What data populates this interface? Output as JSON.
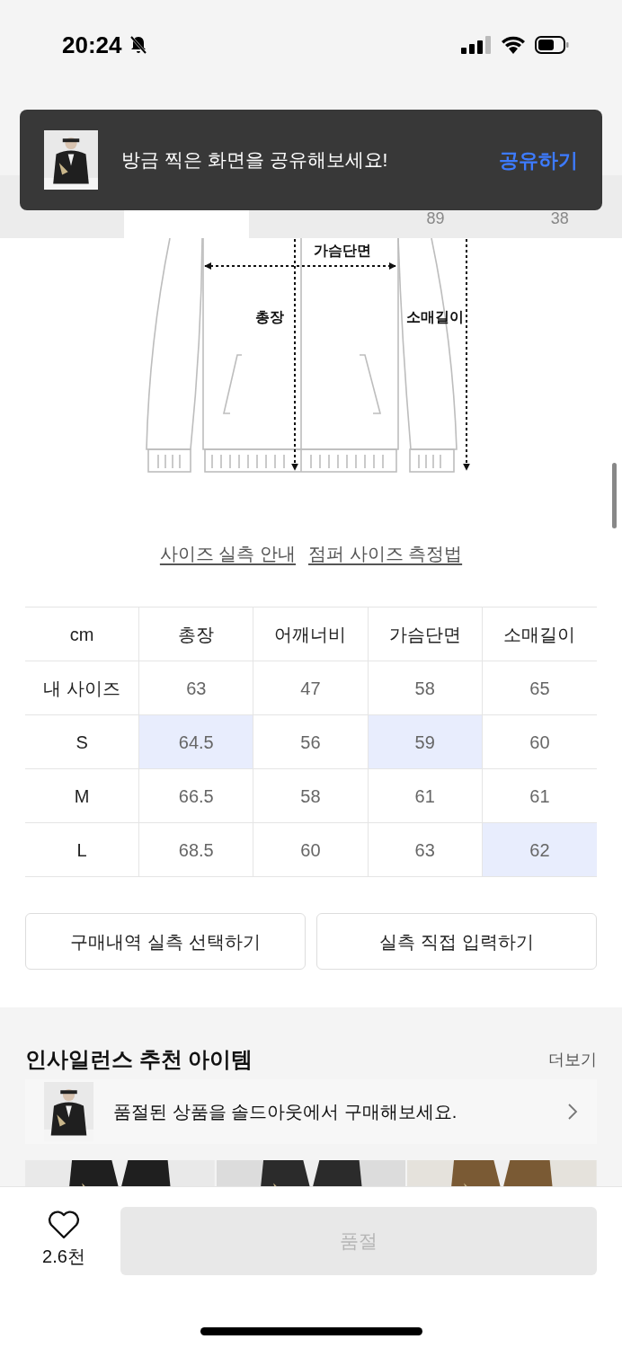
{
  "status_bar": {
    "time": "20:24"
  },
  "toast": {
    "message": "방금 찍은 화면을 공유해보세요!",
    "action": "공유하기"
  },
  "tabs": [
    {
      "selected": false
    },
    {
      "selected": true
    },
    {
      "selected": false
    },
    {
      "selected": false,
      "count": "89"
    },
    {
      "selected": false,
      "count": "38"
    }
  ],
  "size_diagram": {
    "labels": [
      "가슴단면",
      "총장",
      "소매길이"
    ]
  },
  "guide_links": [
    "사이즈 실측 안내",
    "점퍼 사이즈 측정법"
  ],
  "size_table": {
    "columns": [
      "cm",
      "총장",
      "어깨너비",
      "가슴단면",
      "소매길이"
    ],
    "rows": [
      {
        "cells": [
          {
            "text": "내 사이즈",
            "highlighted": false
          },
          {
            "text": "63",
            "highlighted": false
          },
          {
            "text": "47",
            "highlighted": false
          },
          {
            "text": "58",
            "highlighted": false
          },
          {
            "text": "65",
            "highlighted": false
          }
        ]
      },
      {
        "cells": [
          {
            "text": "S",
            "highlighted": false
          },
          {
            "text": "64.5",
            "highlighted": true
          },
          {
            "text": "56",
            "highlighted": false
          },
          {
            "text": "59",
            "highlighted": true
          },
          {
            "text": "60",
            "highlighted": false
          }
        ]
      },
      {
        "cells": [
          {
            "text": "M",
            "highlighted": false
          },
          {
            "text": "66.5",
            "highlighted": false
          },
          {
            "text": "58",
            "highlighted": false
          },
          {
            "text": "61",
            "highlighted": false
          },
          {
            "text": "61",
            "highlighted": false
          }
        ]
      },
      {
        "cells": [
          {
            "text": "L",
            "highlighted": false
          },
          {
            "text": "68.5",
            "highlighted": false
          },
          {
            "text": "60",
            "highlighted": false
          },
          {
            "text": "63",
            "highlighted": false
          },
          {
            "text": "62",
            "highlighted": true
          }
        ]
      }
    ]
  },
  "action_buttons": [
    "구매내역 실측 선택하기",
    "실측 직접 입력하기"
  ],
  "recommend": {
    "title": "인사일런스 추천 아이템",
    "more": "더보기"
  },
  "soldout_banner": {
    "text": "품절된 상품을 솔드아웃에서 구매해보세요."
  },
  "bottom_bar": {
    "likes": "2.6천",
    "buy_button": {
      "label": "품절",
      "disabled": true
    }
  }
}
